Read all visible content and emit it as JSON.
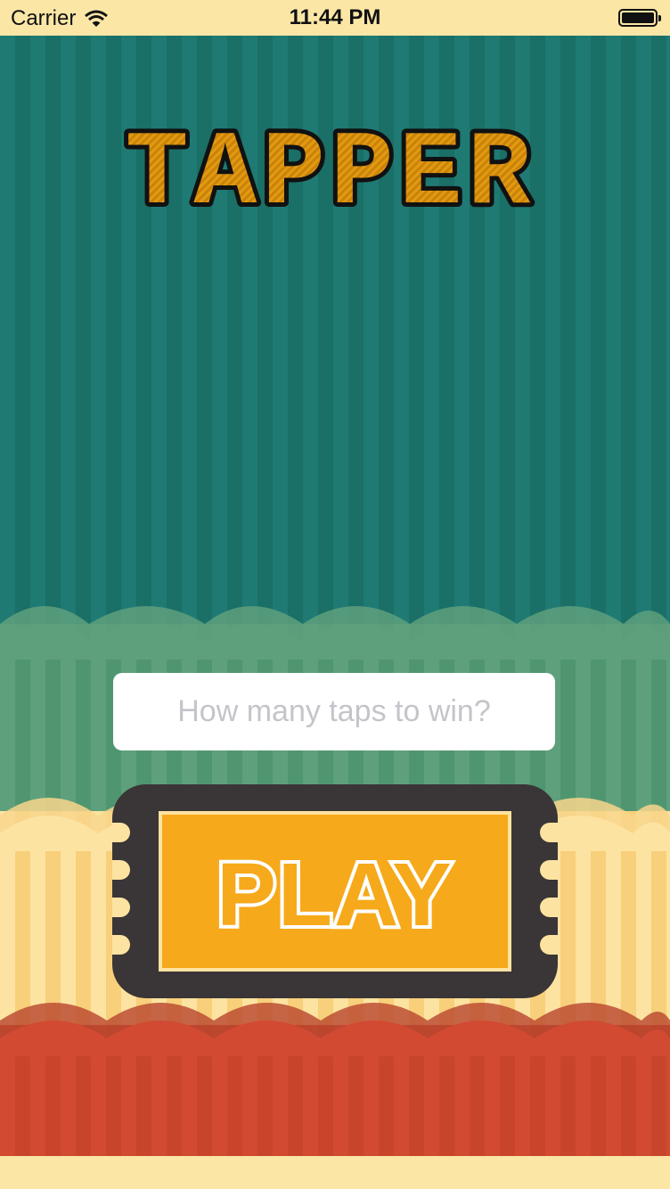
{
  "status_bar": {
    "carrier": "Carrier",
    "time": "11:44 PM"
  },
  "logo": {
    "text": "TAPPER"
  },
  "taps_input": {
    "placeholder": "How many taps to win?",
    "value": ""
  },
  "play_button": {
    "label": "PLAY"
  },
  "colors": {
    "teal": "#1f7a74",
    "green": "#5ea07c",
    "yellow": "#fde3a1",
    "red": "#d24a32",
    "logo_fill": "#e39a10",
    "ticket_dark": "#3a3536",
    "ticket_orange": "#f6a91a"
  },
  "icons": {
    "wifi": "wifi-icon",
    "battery": "battery-icon"
  }
}
